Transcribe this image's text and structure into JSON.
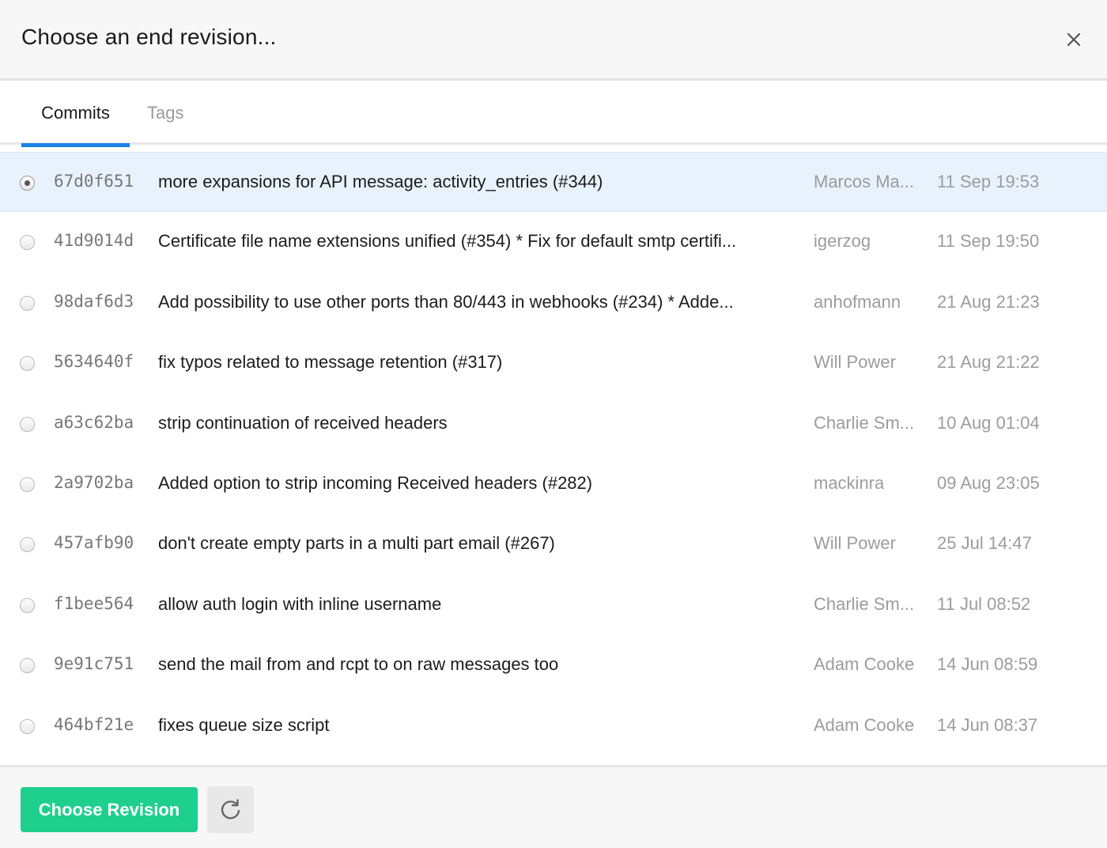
{
  "dialog": {
    "title": "Choose an end revision...",
    "close_icon": "close-icon"
  },
  "tabs": [
    {
      "label": "Commits",
      "active": true
    },
    {
      "label": "Tags",
      "active": false
    }
  ],
  "commits": [
    {
      "hash": "67d0f651",
      "message": "more expansions for API message: activity_entries (#344)",
      "author": "Marcos Ma...",
      "date": "11 Sep 19:53",
      "selected": true
    },
    {
      "hash": "41d9014d",
      "message": "Certificate file name extensions unified (#354) * Fix for default smtp certifi...",
      "author": "igerzog",
      "date": "11 Sep 19:50",
      "selected": false
    },
    {
      "hash": "98daf6d3",
      "message": "Add possibility to use other ports than 80/443 in webhooks (#234) * Adde...",
      "author": "anhofmann",
      "date": "21 Aug 21:23",
      "selected": false
    },
    {
      "hash": "5634640f",
      "message": "fix typos related to message retention (#317)",
      "author": "Will Power",
      "date": "21 Aug 21:22",
      "selected": false
    },
    {
      "hash": "a63c62ba",
      "message": "strip continuation of received headers",
      "author": "Charlie Sm...",
      "date": "10 Aug 01:04",
      "selected": false
    },
    {
      "hash": "2a9702ba",
      "message": "Added option to strip incoming Received headers (#282)",
      "author": "mackinra",
      "date": "09 Aug 23:05",
      "selected": false
    },
    {
      "hash": "457afb90",
      "message": "don't create empty parts in a multi part email (#267)",
      "author": "Will Power",
      "date": "25 Jul 14:47",
      "selected": false
    },
    {
      "hash": "f1bee564",
      "message": "allow auth login with inline username",
      "author": "Charlie Sm...",
      "date": "11 Jul 08:52",
      "selected": false
    },
    {
      "hash": "9e91c751",
      "message": "send the mail from and rcpt to on raw messages too",
      "author": "Adam Cooke",
      "date": "14 Jun 08:59",
      "selected": false
    },
    {
      "hash": "464bf21e",
      "message": "fixes queue size script",
      "author": "Adam Cooke",
      "date": "14 Jun 08:37",
      "selected": false
    }
  ],
  "footer": {
    "choose_label": "Choose Revision",
    "refresh_icon": "refresh-icon"
  },
  "colors": {
    "accent": "#1a83e8",
    "primary_button": "#1ecf8e",
    "selected_row": "#e8f2fd"
  }
}
